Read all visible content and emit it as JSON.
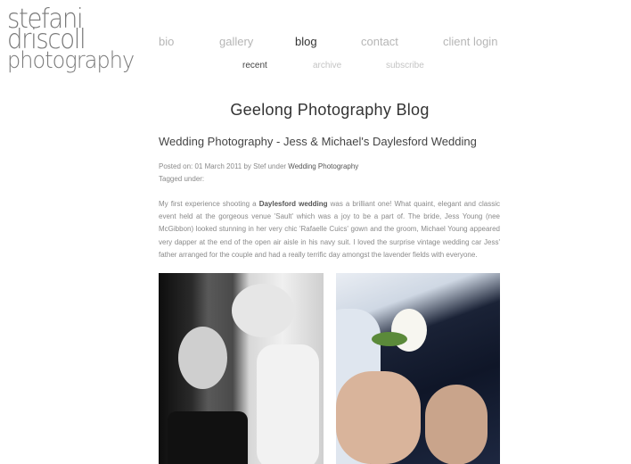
{
  "logo": {
    "line1": "stefani",
    "line2": "driscoll",
    "line3": "photography"
  },
  "nav": {
    "bio": "bio",
    "gallery": "gallery",
    "blog": "blog",
    "contact": "contact",
    "client_login": "client login"
  },
  "subnav": {
    "recent": "recent",
    "archive": "archive",
    "subscribe": "subscribe"
  },
  "blog_title": "Geelong Photography Blog",
  "post": {
    "title": "Wedding Photography - Jess & Michael's Daylesford Wedding",
    "meta_prefix": "Posted on: 01 March 2011 by Stef under ",
    "category": "Wedding Photography",
    "tagged": "Tagged under:",
    "body_pre": "My first experience shooting a ",
    "body_bold": "Daylesford wedding",
    "body_post": " was a brilliant one! What quaint, elegant and classic event held at the gorgeous venue 'Sault' which was a joy to be a part of. The bride, Jess Young (nee McGibbon) looked stunning in her very chic 'Rafaelle Cuics' gown and the groom, Michael Young appeared very dapper at the end of the open air aisle in his navy suit. I loved the surprise vintage wedding car Jess' father arranged for the couple and had a really terrific day amongst the lavender fields with everyone."
  }
}
